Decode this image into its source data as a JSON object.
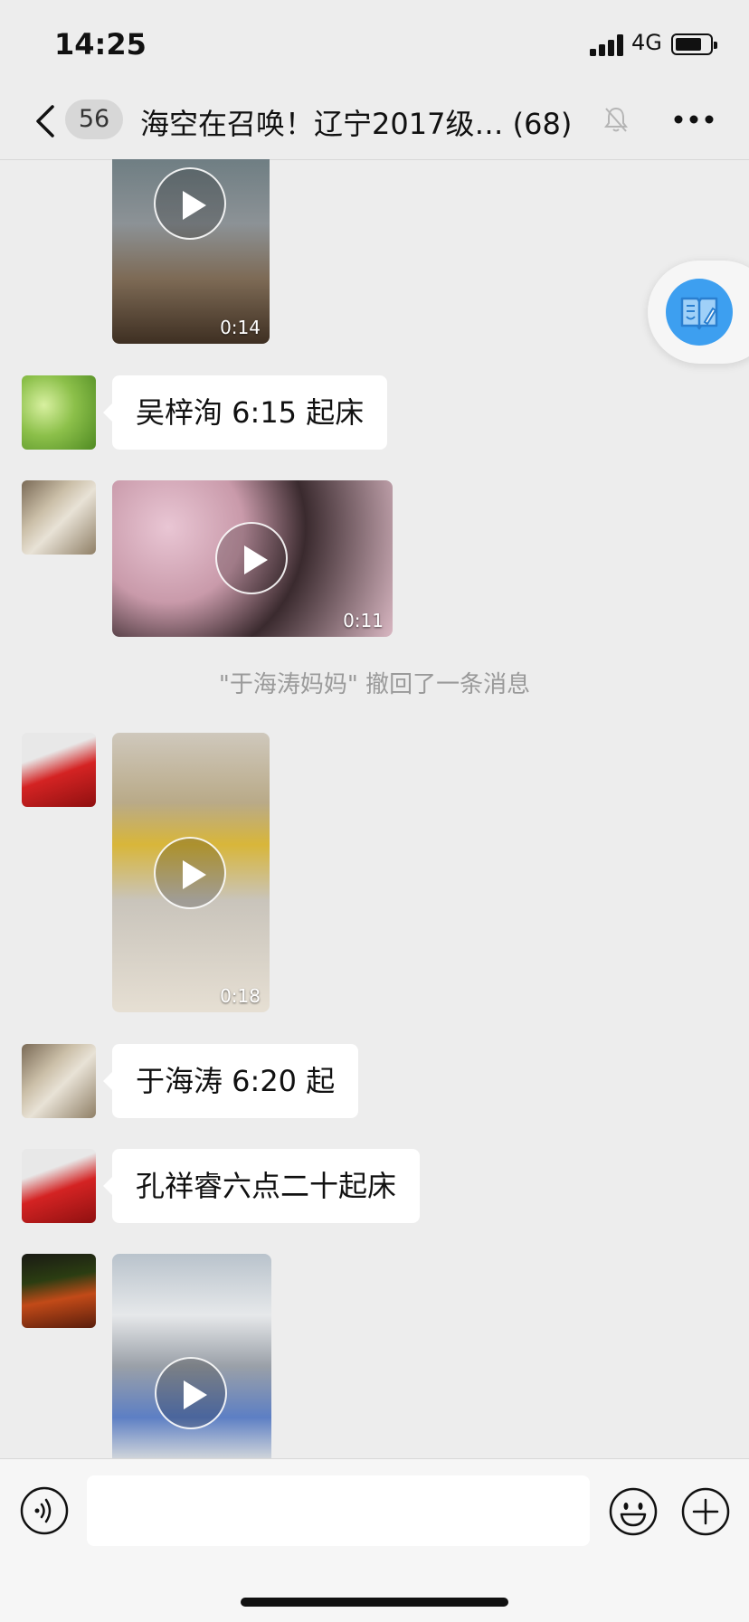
{
  "status_bar": {
    "time": "14:25",
    "network": "4G"
  },
  "nav": {
    "unread_count": "56",
    "title": "海空在召唤！辽宁2017级… (68)"
  },
  "messages": [
    {
      "type": "video",
      "duration": "0:14"
    },
    {
      "type": "text",
      "text": "吴梓洵 6:15 起床"
    },
    {
      "type": "video",
      "duration": "0:11"
    },
    {
      "type": "system",
      "text": "\"于海涛妈妈\" 撤回了一条消息"
    },
    {
      "type": "video",
      "duration": "0:18"
    },
    {
      "type": "text",
      "text": "于海涛 6:20 起"
    },
    {
      "type": "text",
      "text": "孔祥睿六点二十起床"
    },
    {
      "type": "video",
      "duration": ""
    }
  ],
  "input": {
    "placeholder": ""
  },
  "colors": {
    "background": "#ededed",
    "bubble": "#ffffff",
    "accent": "#3d9ff0"
  },
  "icons": [
    "back-icon",
    "mute-bell-icon",
    "more-icon",
    "reading-icon",
    "play-icon",
    "voice-icon",
    "emoji-icon",
    "plus-icon"
  ]
}
